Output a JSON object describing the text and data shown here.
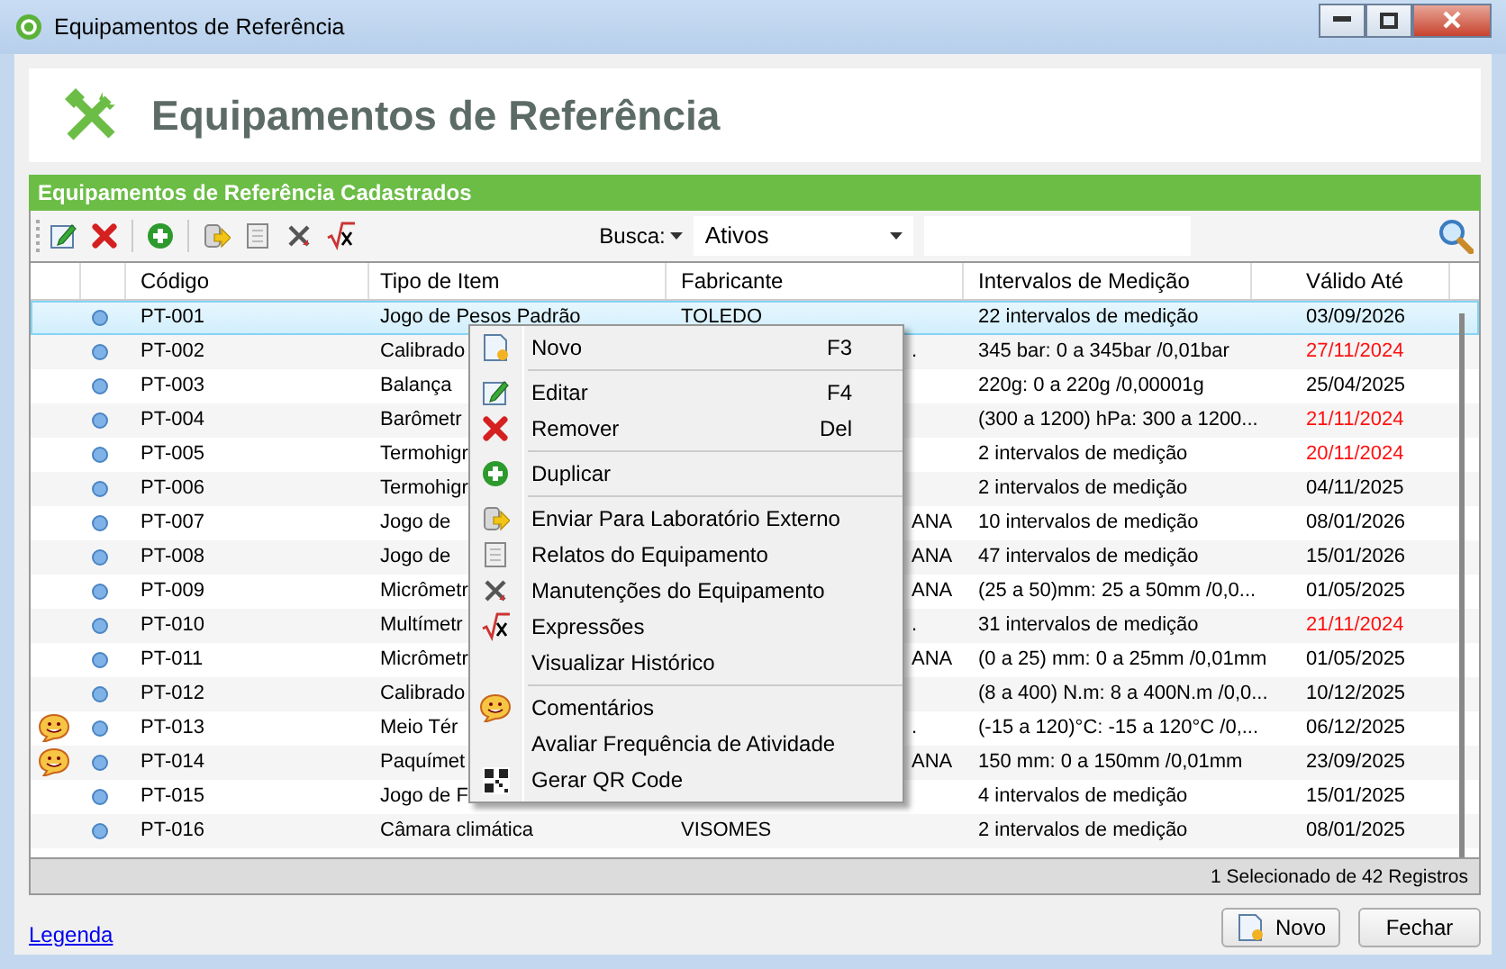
{
  "window": {
    "title": "Equipamentos de Referência"
  },
  "header": {
    "title": "Equipamentos de Referência"
  },
  "panel": {
    "title": "Equipamentos de Referência Cadastrados"
  },
  "toolbar": {
    "search_label": "Busca:",
    "filter": "Ativos"
  },
  "table": {
    "columns": [
      "Código",
      "Tipo de Item",
      "Fabricante",
      "Intervalos de Medição",
      "Válido Até"
    ],
    "rows": [
      {
        "selected": true,
        "covered": false,
        "comment": false,
        "cells": [
          "PT-001",
          "Jogo de Pesos Padrão",
          "TOLEDO",
          "22 intervalos de medição",
          "03/09/2026"
        ],
        "expired": false
      },
      {
        "selected": false,
        "covered": true,
        "comment": false,
        "cells": [
          "PT-002",
          "Calibrado",
          ".",
          "345 bar: 0 a 345bar /0,01bar",
          "27/11/2024"
        ],
        "expired": true
      },
      {
        "selected": false,
        "comment": false,
        "cells": [
          "PT-003",
          "Balança",
          "",
          "220g: 0 a 220g /0,00001g",
          "25/04/2025"
        ],
        "expired": false
      },
      {
        "selected": false,
        "comment": false,
        "cells": [
          "PT-004",
          "Barômetr",
          "",
          "(300 a 1200) hPa: 300 a 1200...",
          "21/11/2024"
        ],
        "expired": true
      },
      {
        "selected": false,
        "comment": false,
        "cells": [
          "PT-005",
          "Termohigr",
          "",
          "2 intervalos de medição",
          "20/11/2024"
        ],
        "expired": true
      },
      {
        "selected": false,
        "comment": false,
        "cells": [
          "PT-006",
          "Termohigr",
          "",
          "2 intervalos de medição",
          "04/11/2025"
        ],
        "expired": false
      },
      {
        "selected": false,
        "covered": true,
        "comment": false,
        "cells": [
          "PT-007",
          "Jogo de",
          "ANA",
          "10 intervalos de medição",
          "08/01/2026"
        ],
        "expired": false
      },
      {
        "selected": false,
        "covered": true,
        "comment": false,
        "cells": [
          "PT-008",
          "Jogo de",
          "ANA",
          "47 intervalos de medição",
          "15/01/2026"
        ],
        "expired": false
      },
      {
        "selected": false,
        "covered": true,
        "comment": false,
        "cells": [
          "PT-009",
          "Micrômetr",
          "ANA",
          "(25  a 50)mm: 25 a 50mm /0,0...",
          "01/05/2025"
        ],
        "expired": false
      },
      {
        "selected": false,
        "covered": true,
        "comment": false,
        "cells": [
          "PT-010",
          "Multímetr",
          ".",
          "31 intervalos de medição",
          "21/11/2024"
        ],
        "expired": true
      },
      {
        "selected": false,
        "covered": true,
        "comment": false,
        "cells": [
          "PT-011",
          "Micrômetr",
          "ANA",
          "(0  a 25) mm: 0 a 25mm /0,01mm",
          "01/05/2025"
        ],
        "expired": false
      },
      {
        "selected": false,
        "comment": false,
        "cells": [
          "PT-012",
          "Calibrado",
          "",
          "(8 a 400) N.m: 8 a 400N.m /0,0...",
          "10/12/2025"
        ],
        "expired": false
      },
      {
        "selected": false,
        "covered": true,
        "comment": true,
        "cells": [
          "PT-013",
          "Meio Tér",
          ".",
          "(-15 a 120)°C: -15 a 120°C /0,...",
          "06/12/2025"
        ],
        "expired": false
      },
      {
        "selected": false,
        "covered": true,
        "comment": true,
        "cells": [
          "PT-014",
          "Paquímet",
          "ANA",
          "150 mm: 0 a 150mm /0,01mm",
          "23/09/2025"
        ],
        "expired": false
      },
      {
        "selected": false,
        "comment": false,
        "cells": [
          "PT-015",
          "Jogo de F",
          "",
          "4 intervalos de medição",
          "15/01/2025"
        ],
        "expired": false
      },
      {
        "selected": false,
        "covered": false,
        "comment": false,
        "cells": [
          "PT-016",
          "Câmara climática",
          "VISOMES",
          "2 intervalos de medição",
          "08/01/2025"
        ],
        "expired": false
      }
    ]
  },
  "context_menu": [
    {
      "kind": "item",
      "label": "Novo",
      "shortcut": "F3"
    },
    {
      "kind": "separator"
    },
    {
      "kind": "item",
      "label": "Editar",
      "shortcut": "F4"
    },
    {
      "kind": "item",
      "label": "Remover",
      "shortcut": "Del"
    },
    {
      "kind": "separator"
    },
    {
      "kind": "item",
      "label": "Duplicar"
    },
    {
      "kind": "separator"
    },
    {
      "kind": "item",
      "label": "Enviar Para Laboratório Externo"
    },
    {
      "kind": "item",
      "label": "Relatos do Equipamento"
    },
    {
      "kind": "item",
      "label": "Manutenções do Equipamento"
    },
    {
      "kind": "item",
      "label": "Expressões"
    },
    {
      "kind": "item",
      "label": "Visualizar Histórico"
    },
    {
      "kind": "separator"
    },
    {
      "kind": "item",
      "label": "Comentários"
    },
    {
      "kind": "item",
      "label": "Avaliar Frequência de Atividade"
    },
    {
      "kind": "item",
      "label": "Gerar QR Code"
    }
  ],
  "status_bar": "1 Selecionado de 42 Registros",
  "footer": {
    "link": "Legenda",
    "buttons": [
      "Novo",
      "Fechar"
    ]
  }
}
